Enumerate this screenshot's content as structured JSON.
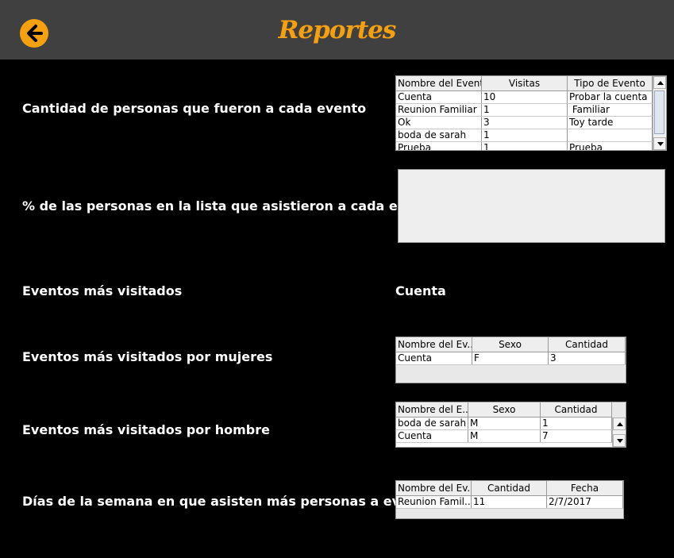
{
  "header": {
    "title": "Reportes",
    "back_icon": "arrow-left-circle-icon",
    "accent": "#f5a00f",
    "bg": "#404040"
  },
  "sections": {
    "count_per_event": "Cantidad de personas que fueron a cada evento",
    "percent_attended": "% de las personas en la lista que asistieron a cada evento",
    "most_visited": "Eventos más visitados",
    "most_visited_value": "Cuenta",
    "by_women": "Eventos más visitados por mujeres",
    "by_men": "Eventos más visitados por hombre",
    "weekdays": "Días de la semana en que asisten más personas a eventos"
  },
  "table_events": {
    "headers": [
      "Nombre del Evento",
      "Visitas",
      "Tipo de Evento"
    ],
    "rows": [
      [
        "Cuenta",
        "10",
        "Probar la cuenta"
      ],
      [
        "Reunion Familiar",
        "1",
        " Familiar"
      ],
      [
        "Ok",
        "3",
        "Toy tarde"
      ],
      [
        "boda de sarah",
        "1",
        ""
      ],
      [
        "Prueba",
        "1",
        "Prueba"
      ]
    ]
  },
  "table_women": {
    "headers": [
      "Nombre del Ev...",
      "Sexo",
      "Cantidad"
    ],
    "rows": [
      [
        "Cuenta",
        "F",
        "3"
      ]
    ]
  },
  "table_men": {
    "headers": [
      "Nombre del E...",
      "Sexo",
      "Cantidad"
    ],
    "rows": [
      [
        "boda de sarah",
        "M",
        "1"
      ],
      [
        "Cuenta",
        "M",
        "7"
      ]
    ]
  },
  "table_days": {
    "headers": [
      "Nombre del Ev...",
      "Cantidad",
      "Fecha"
    ],
    "rows": [
      [
        "Reunion Famil...",
        "11",
        "2/7/2017"
      ]
    ]
  }
}
